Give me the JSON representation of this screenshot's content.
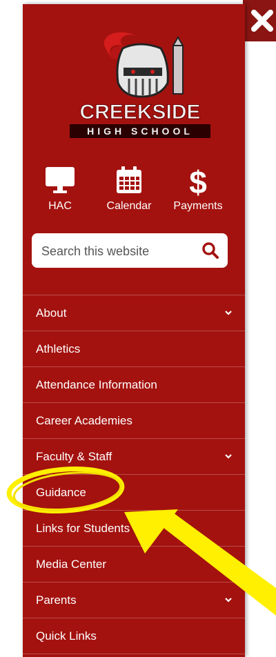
{
  "logo": {
    "name": "CREEKSIDE",
    "subtitle": "HIGH SCHOOL"
  },
  "quick_links": [
    {
      "label": "HAC",
      "icon": "monitor-icon"
    },
    {
      "label": "Calendar",
      "icon": "calendar-icon"
    },
    {
      "label": "Payments",
      "icon": "dollar-icon"
    }
  ],
  "search": {
    "placeholder": "Search this website",
    "icon": "search-icon"
  },
  "menu": [
    {
      "label": "About",
      "expandable": true
    },
    {
      "label": "Athletics",
      "expandable": false
    },
    {
      "label": "Attendance Information",
      "expandable": false
    },
    {
      "label": "Career Academies",
      "expandable": false
    },
    {
      "label": "Faculty & Staff",
      "expandable": true
    },
    {
      "label": "Guidance",
      "expandable": false
    },
    {
      "label": "Links for Students",
      "expandable": false
    },
    {
      "label": "Media Center",
      "expandable": false
    },
    {
      "label": "Parents",
      "expandable": true
    },
    {
      "label": "Quick Links",
      "expandable": false
    }
  ],
  "colors": {
    "drawer": "#a3120f",
    "annotation": "#ffef00"
  }
}
